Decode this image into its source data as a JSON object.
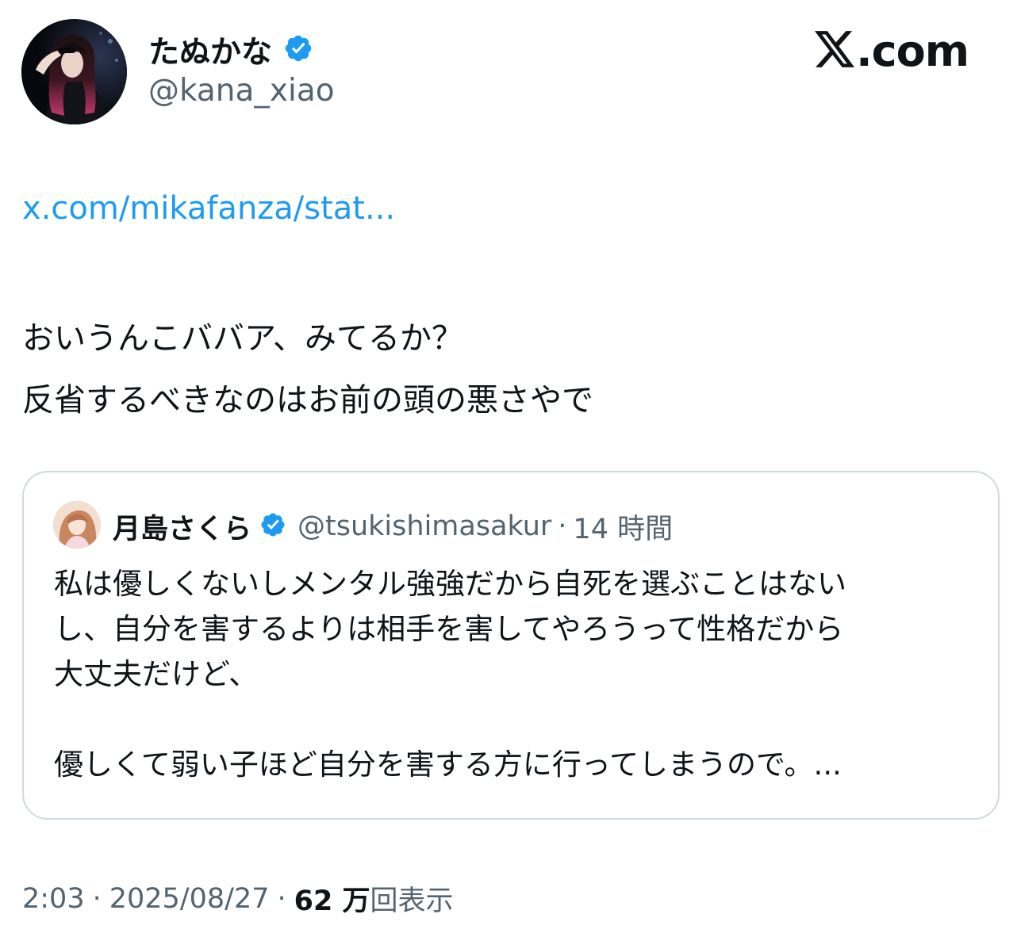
{
  "author": {
    "display_name": "たぬかな",
    "handle": "@kana_xiao",
    "verified": true,
    "avatar_icon": "profile-photo-avatar"
  },
  "site_logo": {
    "mark": "𝕏",
    "text": ".com"
  },
  "tweet": {
    "link": "x.com/mikafanza/stat...",
    "lines": [
      "おいうんこババア、みてるか？",
      "反省するべきなのはお前の頭の悪さやで"
    ]
  },
  "quoted_tweet": {
    "display_name": "月島さくら",
    "handle": "@tsukishimasakur",
    "separator": "·",
    "time": "14 時間",
    "verified": true,
    "lines": [
      "私は優しくないしメンタル強強だから自死を選ぶことはない",
      "し、自分を害するよりは相手を害してやろうって性格だから",
      "大丈夫だけど、",
      "",
      "優しくて弱い子ほど自分を害する方に行ってしまうので。..."
    ]
  },
  "meta": {
    "time": "2:03",
    "separator": "·",
    "date": "2025/08/27",
    "views_count": "62 万",
    "views_label": "回表示"
  },
  "colors": {
    "text": "#0f1419",
    "secondary": "#536471",
    "link": "#1d9bf0",
    "verified_badge": "#1d9bf0",
    "quote_border": "#cfd9de"
  }
}
